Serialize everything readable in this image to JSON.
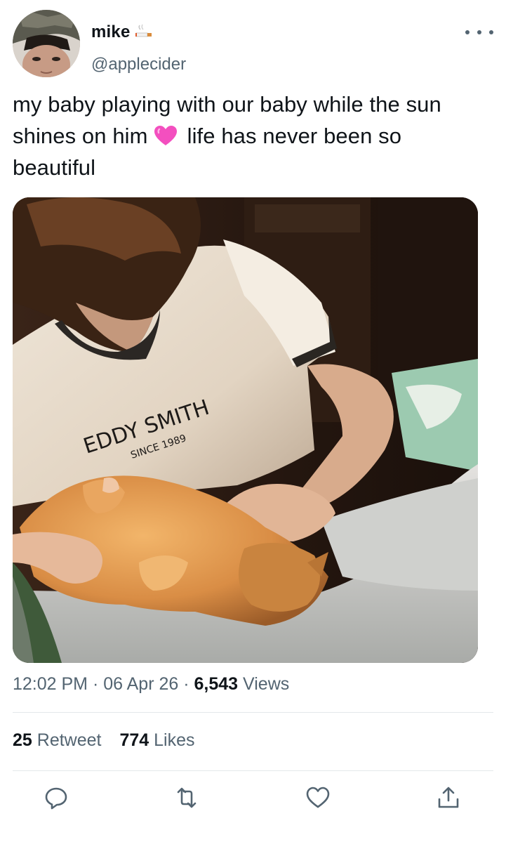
{
  "tweet": {
    "author": {
      "name": "mike",
      "handle": "@applecider"
    },
    "text_line1": "my baby playing with our baby while the sun",
    "text_line2_a": "shines on him",
    "text_line2_b": "life has never been so",
    "text_line3": "beautiful",
    "photo": {
      "shirt_text": "EDDY SMITH",
      "shirt_subtext": "SINCE 1989"
    },
    "time": "12:02 PM",
    "date": "06 Apr 26",
    "views_count": "6,543",
    "views_label": "Views",
    "retweet_count": "25",
    "retweet_label": "Retweet",
    "likes_count": "774",
    "likes_label": "Likes"
  },
  "icons": {
    "name_badge": "cigarette-emoji",
    "inline_emoji": "pink-heart-emoji",
    "more": "more-icon",
    "reply": "reply-icon",
    "retweet": "retweet-icon",
    "like": "like-icon",
    "share": "share-icon"
  },
  "colors": {
    "text": "#0f1419",
    "secondary": "#536471",
    "divider": "#e4e8eb"
  }
}
